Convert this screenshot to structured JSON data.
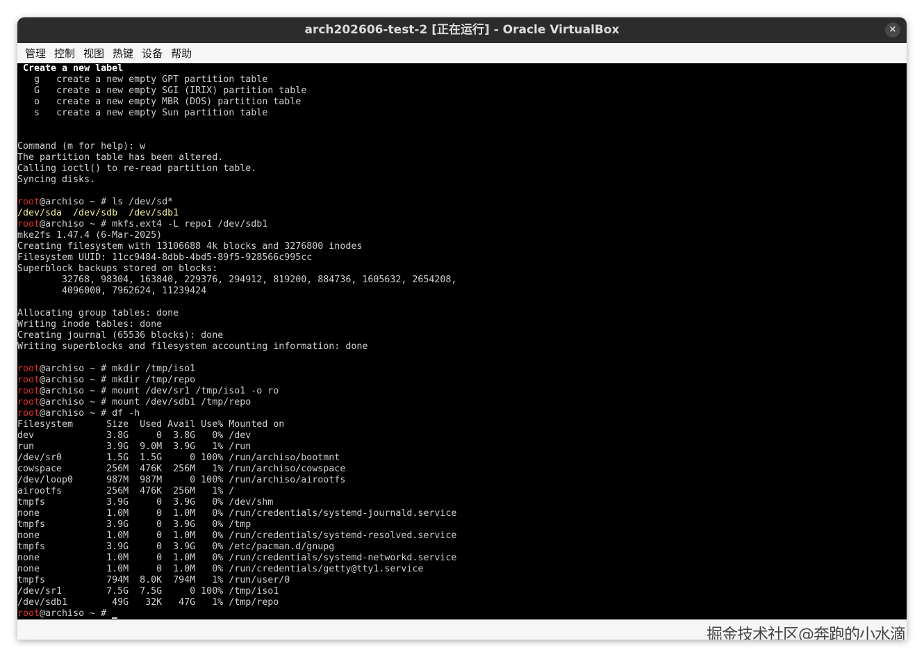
{
  "window": {
    "title": "arch202606-test-2 [正在运行] - Oracle VirtualBox",
    "close_glyph": "×"
  },
  "menu": [
    "管理",
    "控制",
    "视图",
    "热键",
    "设备",
    "帮助"
  ],
  "watermark": "掘金技术社区@奔跑的小水滴",
  "terminal": {
    "prompt_user": "root",
    "prompt_host": "@archiso ~ # ",
    "lines": [
      {
        "type": "bold",
        "text": " Create a new label"
      },
      {
        "type": "plain",
        "text": "   g   create a new empty GPT partition table"
      },
      {
        "type": "plain",
        "text": "   G   create a new empty SGI (IRIX) partition table"
      },
      {
        "type": "plain",
        "text": "   o   create a new empty MBR (DOS) partition table"
      },
      {
        "type": "plain",
        "text": "   s   create a new empty Sun partition table"
      },
      {
        "type": "plain",
        "text": ""
      },
      {
        "type": "plain",
        "text": ""
      },
      {
        "type": "plain",
        "text": "Command (m for help): w"
      },
      {
        "type": "plain",
        "text": "The partition table has been altered."
      },
      {
        "type": "plain",
        "text": "Calling ioctl() to re-read partition table."
      },
      {
        "type": "plain",
        "text": "Syncing disks."
      },
      {
        "type": "plain",
        "text": ""
      },
      {
        "type": "prompt",
        "text": "ls /dev/sd*"
      },
      {
        "type": "yellow",
        "text": "/dev/sda  /dev/sdb  /dev/sdb1"
      },
      {
        "type": "prompt",
        "text": "mkfs.ext4 -L repo1 /dev/sdb1"
      },
      {
        "type": "plain",
        "text": "mke2fs 1.47.4 (6-Mar-2025)"
      },
      {
        "type": "plain",
        "text": "Creating filesystem with 13106688 4k blocks and 3276800 inodes"
      },
      {
        "type": "plain",
        "text": "Filesystem UUID: 11cc9484-8dbb-4bd5-89f5-928566c995cc"
      },
      {
        "type": "plain",
        "text": "Superblock backups stored on blocks:"
      },
      {
        "type": "plain",
        "text": "        32768, 98304, 163840, 229376, 294912, 819200, 884736, 1605632, 2654208,"
      },
      {
        "type": "plain",
        "text": "        4096000, 7962624, 11239424"
      },
      {
        "type": "plain",
        "text": ""
      },
      {
        "type": "plain",
        "text": "Allocating group tables: done"
      },
      {
        "type": "plain",
        "text": "Writing inode tables: done"
      },
      {
        "type": "plain",
        "text": "Creating journal (65536 blocks): done"
      },
      {
        "type": "plain",
        "text": "Writing superblocks and filesystem accounting information: done"
      },
      {
        "type": "plain",
        "text": ""
      },
      {
        "type": "prompt",
        "text": "mkdir /tmp/iso1"
      },
      {
        "type": "prompt",
        "text": "mkdir /tmp/repo"
      },
      {
        "type": "prompt",
        "text": "mount /dev/sr1 /tmp/iso1 -o ro"
      },
      {
        "type": "prompt",
        "text": "mount /dev/sdb1 /tmp/repo"
      },
      {
        "type": "prompt",
        "text": "df -h"
      },
      {
        "type": "plain",
        "text": "Filesystem      Size  Used Avail Use% Mounted on"
      },
      {
        "type": "plain",
        "text": "dev             3.8G     0  3.8G   0% /dev"
      },
      {
        "type": "plain",
        "text": "run             3.9G  9.0M  3.9G   1% /run"
      },
      {
        "type": "plain",
        "text": "/dev/sr0        1.5G  1.5G     0 100% /run/archiso/bootmnt"
      },
      {
        "type": "plain",
        "text": "cowspace        256M  476K  256M   1% /run/archiso/cowspace"
      },
      {
        "type": "plain",
        "text": "/dev/loop0      987M  987M     0 100% /run/archiso/airootfs"
      },
      {
        "type": "plain",
        "text": "airootfs        256M  476K  256M   1% /"
      },
      {
        "type": "plain",
        "text": "tmpfs           3.9G     0  3.9G   0% /dev/shm"
      },
      {
        "type": "plain",
        "text": "none            1.0M     0  1.0M   0% /run/credentials/systemd-journald.service"
      },
      {
        "type": "plain",
        "text": "tmpfs           3.9G     0  3.9G   0% /tmp"
      },
      {
        "type": "plain",
        "text": "none            1.0M     0  1.0M   0% /run/credentials/systemd-resolved.service"
      },
      {
        "type": "plain",
        "text": "tmpfs           3.9G     0  3.9G   0% /etc/pacman.d/gnupg"
      },
      {
        "type": "plain",
        "text": "none            1.0M     0  1.0M   0% /run/credentials/systemd-networkd.service"
      },
      {
        "type": "plain",
        "text": "none            1.0M     0  1.0M   0% /run/credentials/getty@tty1.service"
      },
      {
        "type": "plain",
        "text": "tmpfs           794M  8.0K  794M   1% /run/user/0"
      },
      {
        "type": "plain",
        "text": "/dev/sr1        7.5G  7.5G     0 100% /tmp/iso1"
      },
      {
        "type": "plain",
        "text": "/dev/sdb1        49G   32K   47G   1% /tmp/repo"
      },
      {
        "type": "cursor",
        "text": ""
      }
    ]
  }
}
